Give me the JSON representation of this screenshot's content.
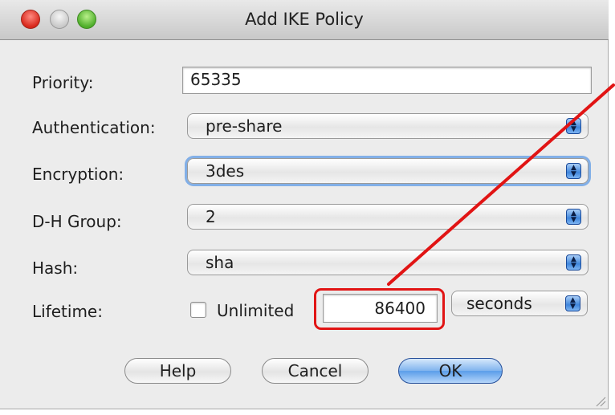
{
  "window": {
    "title": "Add IKE Policy"
  },
  "form": {
    "priority": {
      "label": "Priority:",
      "value": "65335"
    },
    "authentication": {
      "label": "Authentication:",
      "value": "pre-share"
    },
    "encryption": {
      "label": "Encryption:",
      "value": "3des"
    },
    "dh_group": {
      "label": "D-H Group:",
      "value": "2"
    },
    "hash": {
      "label": "Hash:",
      "value": "sha"
    },
    "lifetime": {
      "label": "Lifetime:",
      "unlimited_label": "Unlimited",
      "unlimited_checked": false,
      "value": "86400",
      "unit": "seconds"
    }
  },
  "buttons": {
    "help": "Help",
    "cancel": "Cancel",
    "ok": "OK"
  },
  "annotation": {
    "color": "#e11414"
  },
  "icons": {
    "close": "close-traffic-light-icon",
    "minimize": "minimize-traffic-light-icon",
    "zoom": "zoom-traffic-light-icon",
    "select_arrows": "updown-arrows-icon",
    "resize": "resize-grip-icon"
  }
}
